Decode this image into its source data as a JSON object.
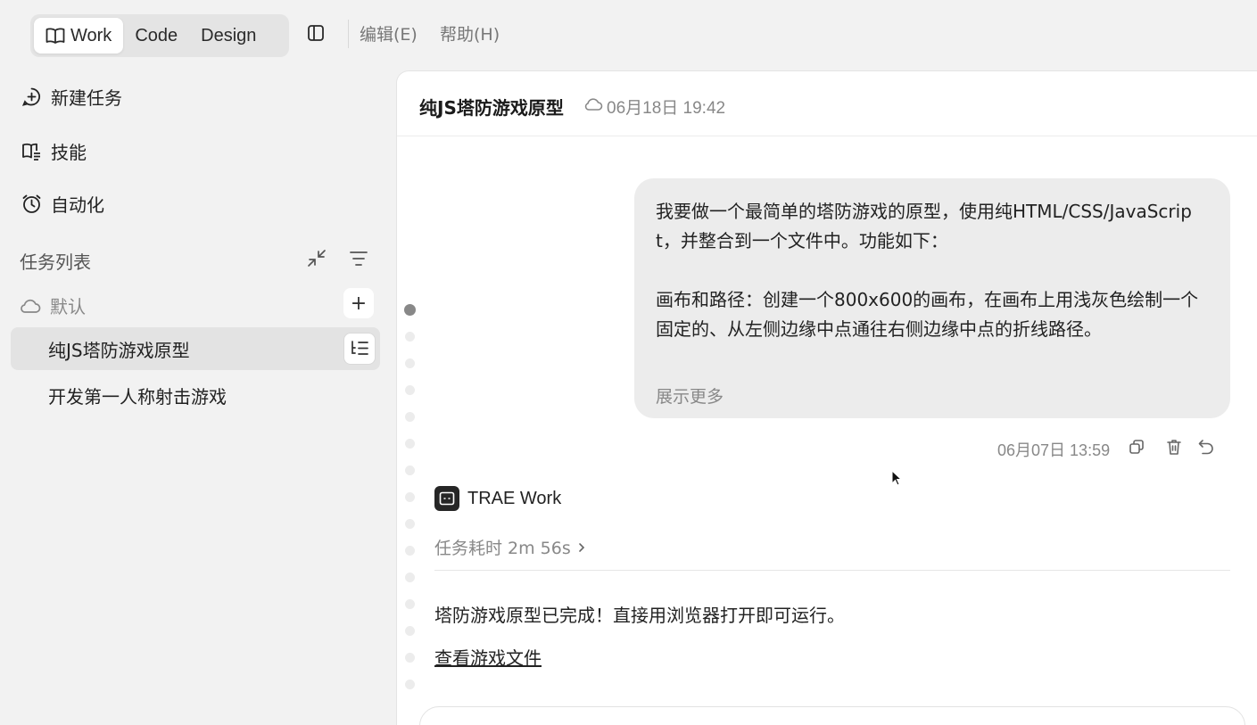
{
  "topbar": {
    "modes": [
      {
        "label": "Work",
        "icon": "book-open-icon",
        "active": true
      },
      {
        "label": "Code",
        "active": false
      },
      {
        "label": "Design",
        "active": false
      }
    ],
    "menus": [
      "编辑(E)",
      "帮助(H)"
    ]
  },
  "sidebar": {
    "nav": [
      {
        "label": "新建任务",
        "icon": "new-chat-icon"
      },
      {
        "label": "技能",
        "icon": "skills-book-icon"
      },
      {
        "label": "自动化",
        "icon": "alarm-clock-icon"
      }
    ],
    "section_title": "任务列表",
    "group_label": "默认",
    "add_label": "+",
    "tasks": [
      {
        "label": "纯JS塔防游戏原型",
        "active": true
      },
      {
        "label": "开发第一人称射击游戏",
        "active": false
      }
    ]
  },
  "chat": {
    "title": "纯JS塔防游戏原型",
    "updated": "06月18日 19:42",
    "user_message": "我要做一个最简单的塔防游戏的原型，使用纯HTML/CSS/JavaScript，并整合到一个文件中。功能如下：\n\n画布和路径：创建一个800x600的画布，在画布上用浅灰色绘制一个固定的、从左侧边缘中点通往右侧边缘中点的折线路径。",
    "show_more": "展示更多",
    "message_time": "06月07日 13:59",
    "agent_name": "TRAE Work",
    "duration": "任务耗时 2m 56s",
    "reply": "塔防游戏原型已完成！直接用浏览器打开即可运行。",
    "file_link": "查看游戏文件"
  },
  "colors": {
    "background": "#f2f2f2",
    "panel": "#ffffff",
    "bubble": "#ececec",
    "muted_text": "#888888",
    "avatar": "#262626"
  }
}
